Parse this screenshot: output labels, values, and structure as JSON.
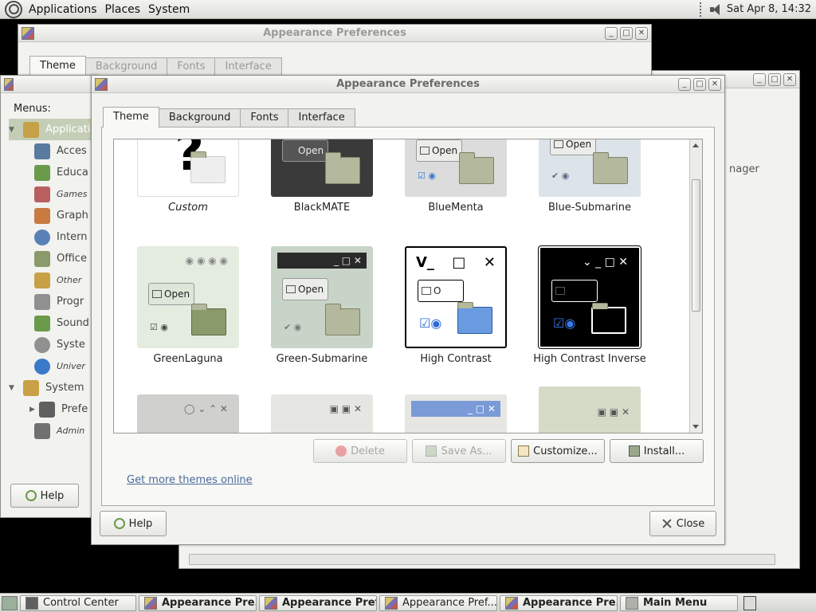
{
  "top_panel": {
    "menus": [
      "Applications",
      "Places",
      "System"
    ],
    "clock": "Sat Apr  8, 14:32"
  },
  "back_window": {
    "title": "Appearance Preferences",
    "tabs": [
      "Theme",
      "Background",
      "Fonts",
      "Interface"
    ]
  },
  "right_window": {
    "partial_text": "nager"
  },
  "control_center": {
    "menus_label": "Menus:",
    "items": [
      {
        "label": "Applicati",
        "color": "#c8a048"
      },
      {
        "label": "Acces",
        "color": "#5a7aa0"
      },
      {
        "label": "Educa",
        "color": "#6a9a4a"
      },
      {
        "label": "Games",
        "color": "#b86060"
      },
      {
        "label": "Graph",
        "color": "#c87a40"
      },
      {
        "label": "Intern",
        "color": "#5a80b8"
      },
      {
        "label": "Office",
        "color": "#8a9a6a"
      },
      {
        "label": "Other",
        "color": "#c8a048"
      },
      {
        "label": "Progr",
        "color": "#909090"
      },
      {
        "label": "Sound",
        "color": "#6a9a4a"
      },
      {
        "label": "Syste",
        "color": "#909090"
      },
      {
        "label": "Univer",
        "color": "#3a7ac8"
      },
      {
        "label": "System",
        "color": "#c8a048"
      },
      {
        "label": "Prefe",
        "color": "#606060"
      },
      {
        "label": "Admin",
        "color": "#707070"
      }
    ],
    "help_label": "Help"
  },
  "main_window": {
    "title": "Appearance Preferences",
    "tabs": [
      "Theme",
      "Background",
      "Fonts",
      "Interface"
    ],
    "themes": [
      {
        "name": "Custom",
        "bg": "#ffffff"
      },
      {
        "name": "BlackMATE",
        "bg": "#3a3a3a"
      },
      {
        "name": "BlueMenta",
        "bg": "#dcdcdc"
      },
      {
        "name": "Blue-Submarine",
        "bg": "#dce4ea"
      },
      {
        "name": "GreenLaguna",
        "bg": "#e4ece0"
      },
      {
        "name": "Green-Submarine",
        "bg": "#c8d4c8"
      },
      {
        "name": "High Contrast",
        "bg": "#ffffff"
      },
      {
        "name": "High Contrast Inverse",
        "bg": "#000000"
      }
    ],
    "buttons": {
      "delete": "Delete",
      "save_as": "Save As...",
      "customize": "Customize...",
      "install": "Install..."
    },
    "get_more_link": "Get more themes online",
    "help_label": "Help",
    "close_label": "Close",
    "accent_link": "#4a6a9a"
  },
  "taskbar": {
    "tasks": [
      {
        "label": "Control Center",
        "bold": false
      },
      {
        "label": "Appearance Pre...",
        "bold": true
      },
      {
        "label": "Appearance Pref...",
        "bold": true
      },
      {
        "label": "Appearance Pref...",
        "bold": false
      },
      {
        "label": "Appearance Pre...",
        "bold": true
      },
      {
        "label": "Main Menu",
        "bold": true
      }
    ]
  }
}
